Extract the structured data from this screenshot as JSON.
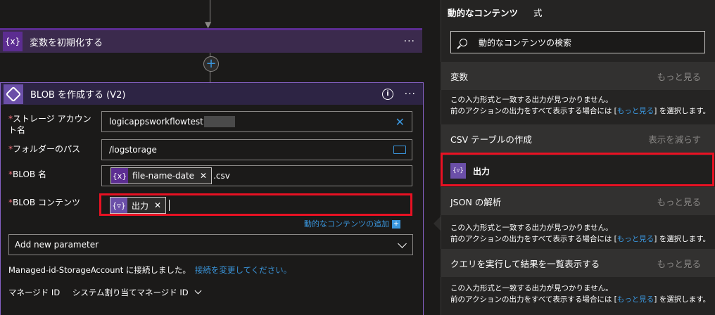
{
  "variables_card": {
    "icon_text": "{x}",
    "title": "変数を初期化する"
  },
  "blob_card": {
    "title": "BLOB を作成する (V2)",
    "fields": [
      {
        "label_line1": "ストレージ アカウン",
        "label_line2": "ト名",
        "value": "logicappsworkflowtest"
      },
      {
        "label": "フォルダーのパス",
        "value": "/logstorage"
      },
      {
        "label": "BLOB 名",
        "token": "file-name-date",
        "suffix": ".csv"
      },
      {
        "label": "BLOB コンテンツ",
        "token": "出力"
      }
    ],
    "add_dynamic_content": "動的なコンテンツの追加",
    "add_new_parameter": "Add new parameter",
    "connection_text": "Managed-id-StorageAccount に接続しました。",
    "change_connection_link": "接続を変更してください。",
    "managed_id_label": "マネージド ID",
    "managed_id_value": "システム割り当てマネージド ID"
  },
  "panel": {
    "tabs": [
      "動的なコンテンツ",
      "式"
    ],
    "search_placeholder": "動的なコンテンツの検索",
    "sections": [
      {
        "title": "変数",
        "action": "もっと見る"
      },
      {
        "title": "CSV テーブルの作成",
        "action": "表示を減らす"
      },
      {
        "title": "JSON の解析",
        "action": "もっと見る"
      },
      {
        "title": "クエリを実行して結果を一覧表示する",
        "action": "もっと見る"
      }
    ],
    "no_match_line1": "この入力形式と一致する出力が見つかりません。",
    "no_match_line2_pre": "前のアクションの出力をすべて表示する場合には [",
    "no_match_link": "もっと見る",
    "no_match_line2_post": "] を選択します。",
    "output_item": "出力"
  }
}
